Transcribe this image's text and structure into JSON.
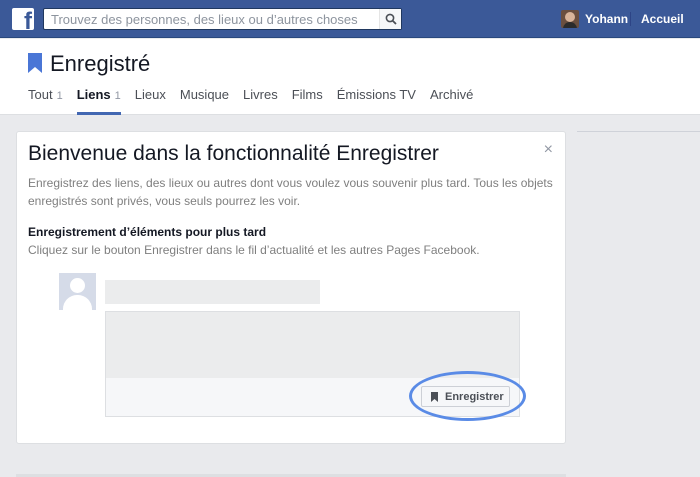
{
  "topbar": {
    "logo_letter": "f",
    "search_placeholder": "Trouvez des personnes, des lieux ou d’autres choses",
    "user_name": "Yohann",
    "home_label": "Accueil"
  },
  "header": {
    "title": "Enregistré",
    "tabs": [
      {
        "label": "Tout",
        "count": "1"
      },
      {
        "label": "Liens",
        "count": "1"
      },
      {
        "label": "Lieux",
        "count": ""
      },
      {
        "label": "Musique",
        "count": ""
      },
      {
        "label": "Livres",
        "count": ""
      },
      {
        "label": "Films",
        "count": ""
      },
      {
        "label": "Émissions TV",
        "count": ""
      },
      {
        "label": "Archivé",
        "count": ""
      }
    ],
    "active_tab": "Liens"
  },
  "card": {
    "close_symbol": "×",
    "title": "Bienvenue dans la fonctionnalité Enregistrer",
    "description": "Enregistrez des liens, des lieux ou autres dont vous voulez vous souvenir plus tard. Tous les objets enregistrés sont privés, vous seuls pourrez les voir.",
    "section_title": "Enregistrement d’éléments pour plus tard",
    "section_description": "Cliquez sur le bouton Enregistrer dans le fil d’actualité et les autres Pages Facebook.",
    "save_button_label": "Enregistrer"
  },
  "colors": {
    "brand": "#3b5998",
    "accent": "#4267b2",
    "highlight": "#5a8be6"
  },
  "icons": [
    "facebook-logo-icon",
    "search-icon",
    "bookmark-icon",
    "close-icon",
    "avatar-placeholder-icon"
  ]
}
